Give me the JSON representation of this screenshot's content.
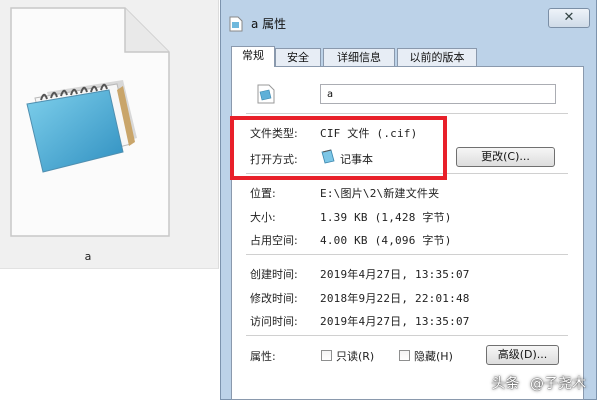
{
  "thumbnail": {
    "file_label": "a",
    "icon": "notepad-file-icon"
  },
  "dialog": {
    "title": "a 属性",
    "close_glyph": "✕",
    "tabs": [
      {
        "label": "常规",
        "active": true
      },
      {
        "label": "安全",
        "active": false
      },
      {
        "label": "详细信息",
        "active": false
      },
      {
        "label": "以前的版本",
        "active": false
      }
    ],
    "general": {
      "file_name_value": "a",
      "file_type_label": "文件类型:",
      "file_type_value": "CIF 文件 (.cif)",
      "open_with_label": "打开方式:",
      "open_with_value": "记事本",
      "change_button": "更改(C)...",
      "location_label": "位置:",
      "location_value": "E:\\图片\\2\\新建文件夹",
      "size_label": "大小:",
      "size_value": "1.39 KB (1,428 字节)",
      "size_on_disk_label": "占用空间:",
      "size_on_disk_value": "4.00 KB (4,096 字节)",
      "created_label": "创建时间:",
      "created_value": "2019年4月27日, 13:35:07",
      "modified_label": "修改时间:",
      "modified_value": "2018年9月22日, 22:01:48",
      "accessed_label": "访问时间:",
      "accessed_value": "2019年4月27日, 13:35:07",
      "attributes_label": "属性:",
      "readonly_label": "只读(R)",
      "readonly_checked": false,
      "hidden_label": "隐藏(H)",
      "hidden_checked": false,
      "advanced_button": "高级(D)..."
    }
  },
  "watermark": {
    "platform": "头条",
    "author": "@子尧木"
  },
  "colors": {
    "highlight_border": "#e8202a",
    "dialog_frame": "#bcd2e8"
  }
}
